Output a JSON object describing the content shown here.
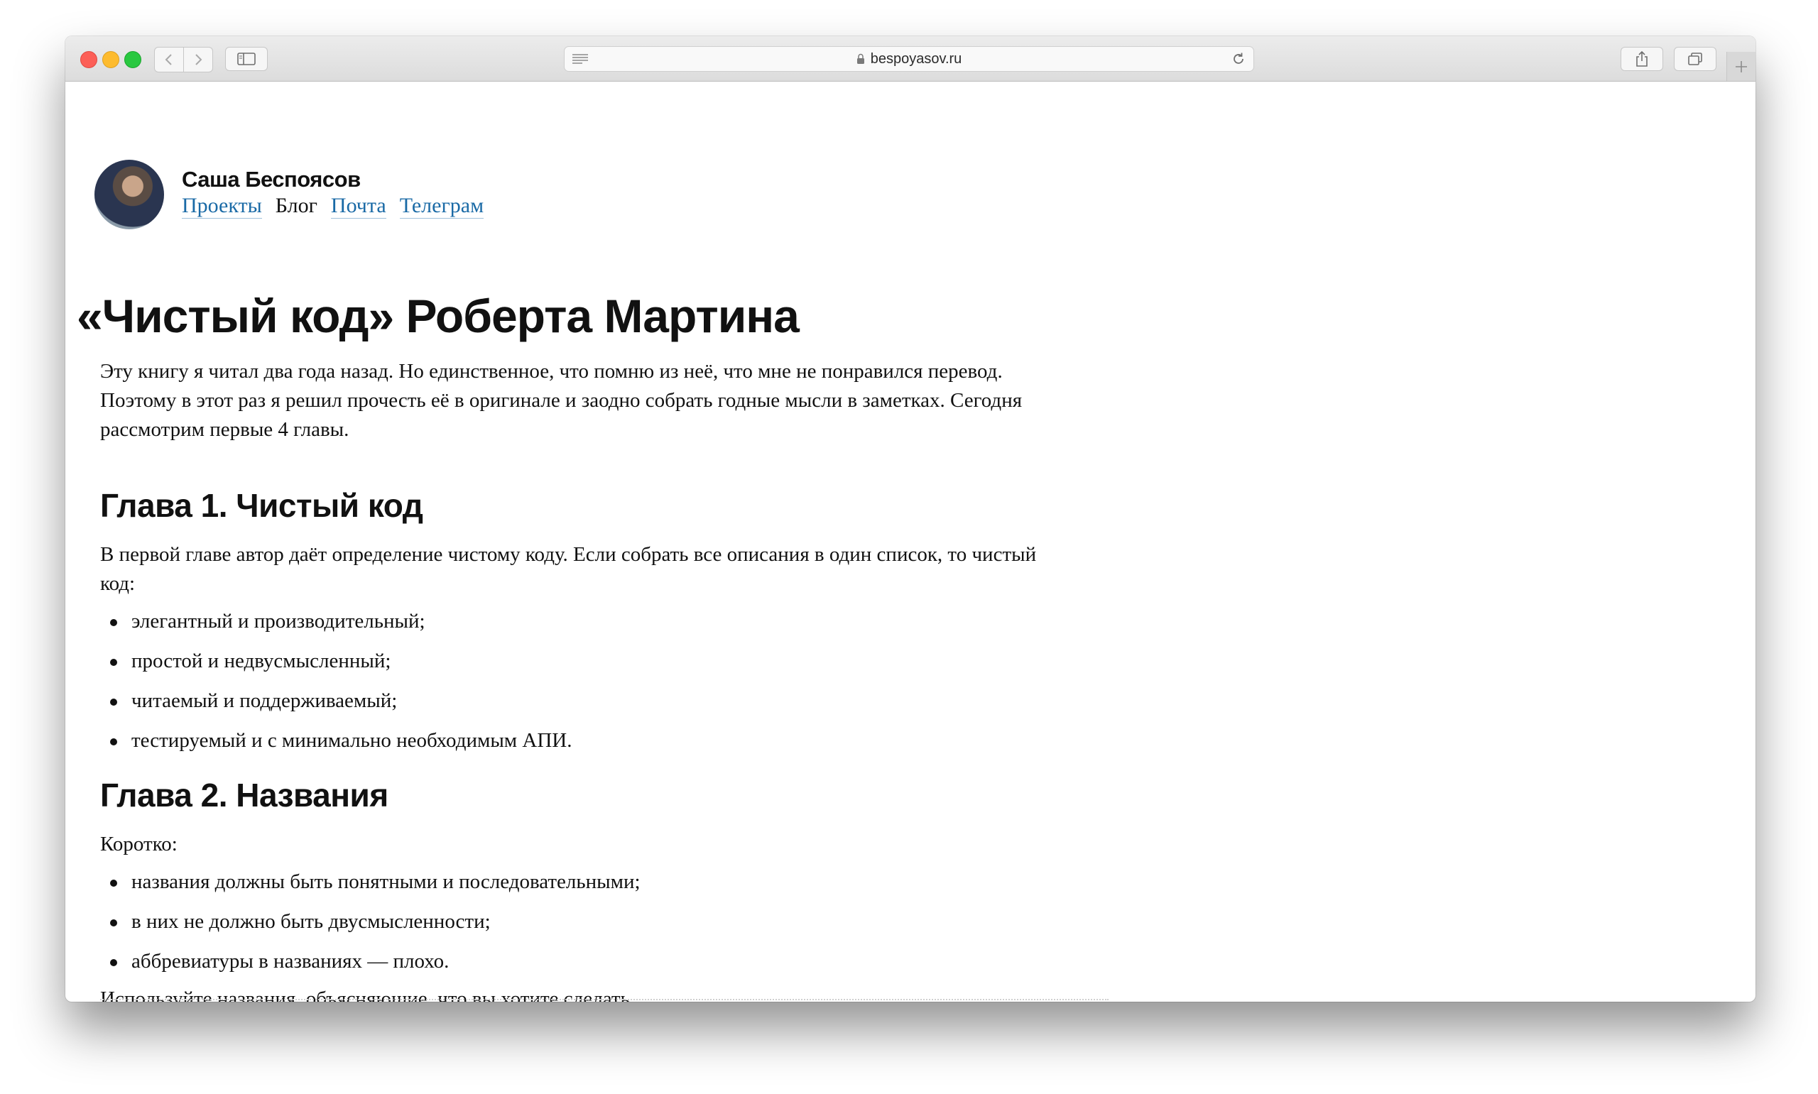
{
  "browser": {
    "url": "bespoyasov.ru"
  },
  "site": {
    "author": "Саша Беспоясов",
    "nav": [
      {
        "label": "Проекты",
        "current": false
      },
      {
        "label": "Блог",
        "current": true
      },
      {
        "label": "Почта",
        "current": false
      },
      {
        "label": "Телеграм",
        "current": false
      }
    ]
  },
  "post": {
    "title": "«Чистый код» Роберта Мартина",
    "intro": "Эту книгу я читал два года назад. Но единственное, что помню из неё, что мне не понравился перевод. Поэтому в этот раз я решил прочесть её в оригинале и заодно собрать годные мысли в заметках. Сегодня рассмотрим первые 4 главы.",
    "chapter1": {
      "heading": "Глава 1. Чистый код",
      "text": "В первой главе автор даёт определение чистому коду. Если собрать все описания в один список, то чистый код:",
      "items": [
        "элегантный и производительный;",
        "простой и недвусмысленный;",
        "читаемый и поддерживаемый;",
        "тестируемый и с минимально необходимым АПИ."
      ]
    },
    "chapter2": {
      "heading": "Глава 2. Названия",
      "text": "Коротко:",
      "items": [
        "названия должны быть понятными и последовательными;",
        "в них не должно быть двусмысленности;",
        "аббревиатуры в названиях — плохо."
      ],
      "outro": "Используйте названия, объясняющие, что вы хотите сделать."
    }
  }
}
